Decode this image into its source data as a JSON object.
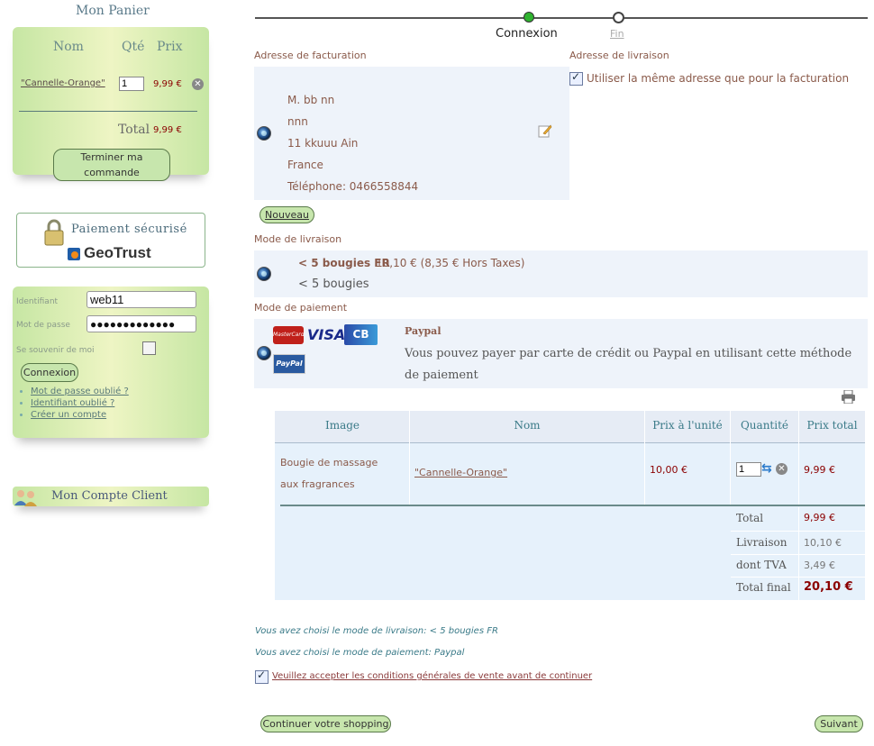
{
  "sidebar": {
    "cart": {
      "title": "Mon Panier",
      "col_name": "Nom",
      "col_qty": "Qté",
      "col_price": "Prix",
      "item_name": "\"Cannelle-Orange\"",
      "item_qty": "1",
      "item_price": "9,99 €",
      "total_label": "Total",
      "total_value": "9,99 €",
      "checkout_button": "Terminer ma commande"
    },
    "secure": {
      "label": "Paiement sécurisé",
      "brand": "GeoTrust"
    },
    "login": {
      "id_label": "Identifiant",
      "id_value": "web11",
      "pw_label": "Mot de passe",
      "pw_value": "●●●●●●●●●●●●●",
      "remember_label": "Se souvenir de moi",
      "button": "Connexion",
      "links": [
        "Mot de passe oublié ?",
        "Identifiant oublié ?",
        "Créer un compte"
      ]
    },
    "account": {
      "title": "Mon Compte Client"
    }
  },
  "steps": {
    "current": "Connexion",
    "next": "Fin"
  },
  "billing": {
    "section_title": "Adresse de facturation",
    "lines": [
      "M. bb nn",
      "nnn",
      "11 kkuuu Ain",
      "France",
      "Téléphone: 0466558844"
    ],
    "new_button": "Nouveau"
  },
  "shipping": {
    "section_title": "Adresse de livraison",
    "same_label": "Utiliser la même adresse que pour la facturation"
  },
  "delivery": {
    "section_title": "Mode de livraison",
    "name": "< 5 bougies FR",
    "price": "10,10 € (8,35 € Hors Taxes)",
    "desc": "< 5 bougies"
  },
  "payment": {
    "section_title": "Mode de paiement",
    "name": "Paypal",
    "desc": "Vous pouvez payer par carte de crédit ou Paypal en utilisant cette méthode de paiement",
    "logos": [
      "MasterCard",
      "VISA",
      "CB",
      "PayPal"
    ]
  },
  "order_table": {
    "headers": [
      "Image",
      "Nom",
      "Prix à l'unité",
      "Quantité",
      "Prix total"
    ],
    "row": {
      "image_alt": "Bougie de massage aux fragrances",
      "name": "\"Cannelle-Orange\"",
      "unit_price": "10,00 €",
      "qty": "1",
      "total": "9,99 €"
    },
    "totals": [
      {
        "label": "Total",
        "value": "9,99 €"
      },
      {
        "label": "Livraison",
        "value": "10,10 €"
      },
      {
        "label": "dont TVA",
        "value": "3,49 €"
      },
      {
        "label": "Total final",
        "value": "20,10 €"
      }
    ]
  },
  "summary": {
    "delivery_line": "Vous avez choisi le mode de livraison: < 5 bougies FR",
    "payment_line": "Vous avez choisi le mode de paiement: Paypal",
    "terms_label": "Veuillez accepter les conditions générales de vente avant de continuer"
  },
  "footer_buttons": {
    "continue": "Continuer votre shopping",
    "next": "Suivant"
  },
  "colors": {
    "accent_green": "#c7e6ad",
    "table_header_bg": "#e6ecf5",
    "table_row_bg": "#e6f1fb",
    "price_red": "#8b0000",
    "link_teal": "#3a7a88"
  }
}
